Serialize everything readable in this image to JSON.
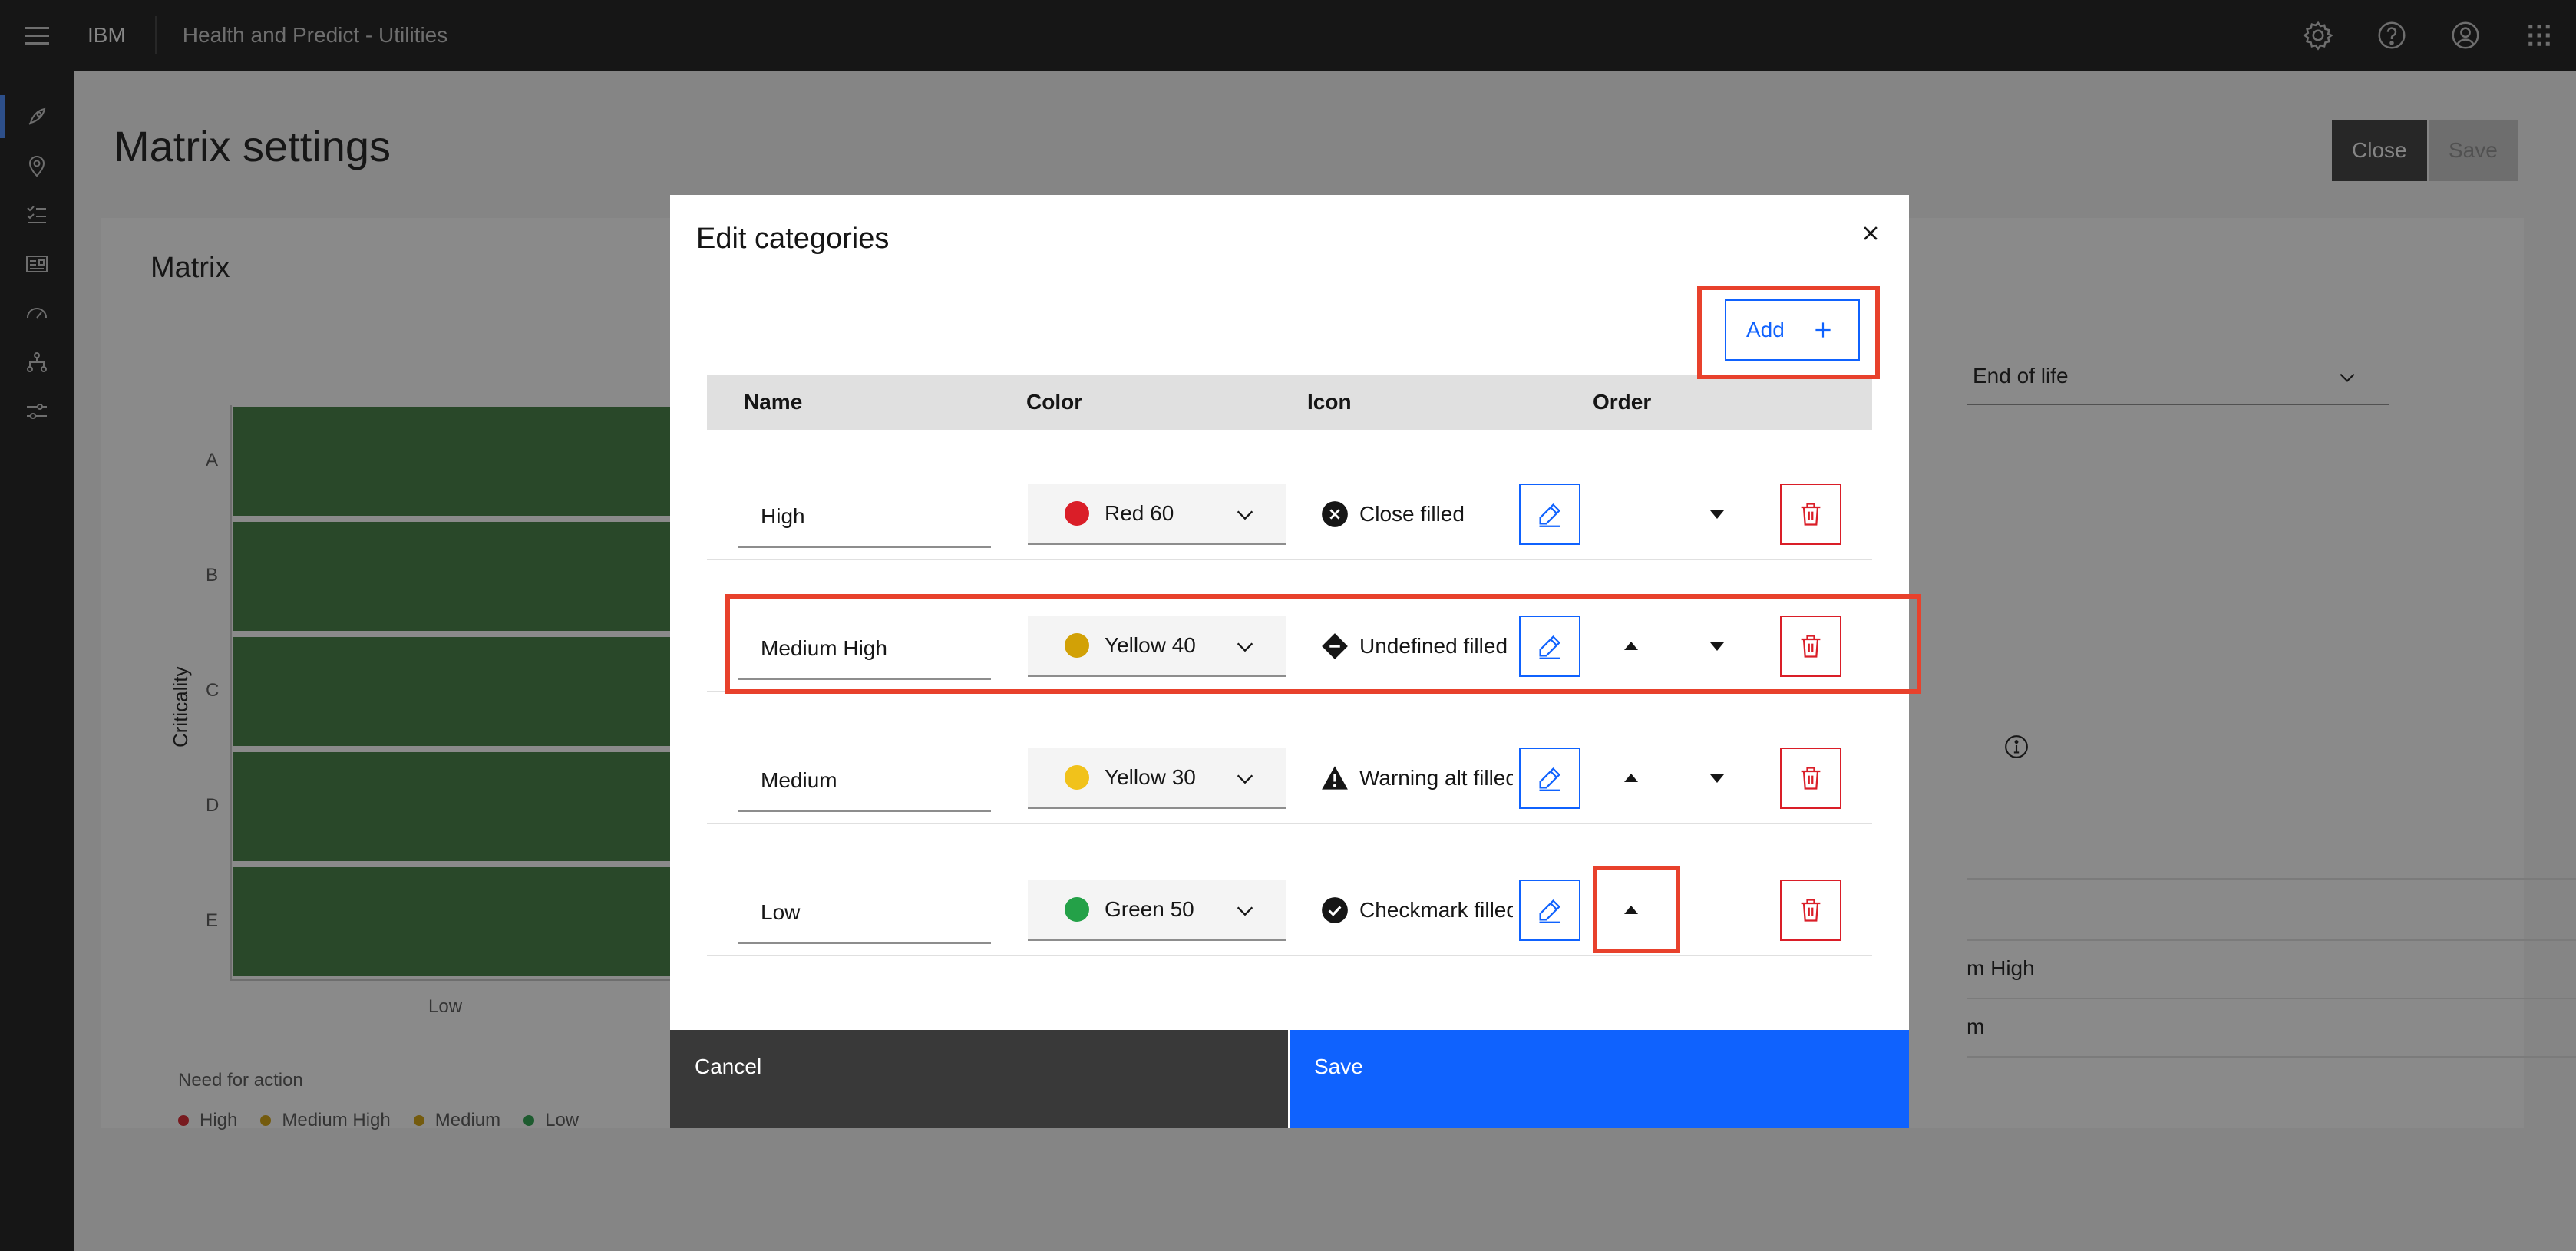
{
  "header": {
    "brand": "IBM",
    "app_title": "Health and Predict - Utilities",
    "icons": [
      "settings-icon",
      "help-icon",
      "user-avatar-icon",
      "app-switcher-icon"
    ]
  },
  "sidenav": {
    "icons": [
      "rocket-icon",
      "location-icon",
      "checklist-icon",
      "dashboard-icon",
      "meter-icon",
      "hierarchy-icon",
      "sliders-icon"
    ]
  },
  "page": {
    "title": "Matrix settings",
    "close_label": "Close",
    "save_label": "Save"
  },
  "matrix": {
    "title": "Matrix",
    "y_axis_label": "Criticality",
    "rows": [
      "A",
      "B",
      "C",
      "D",
      "E"
    ],
    "columns": [
      "Low"
    ],
    "cell_color": "#3d7a3d",
    "legend_title": "Need for action",
    "legend": [
      {
        "label": "High",
        "color": "#da1e28"
      },
      {
        "label": "Medium High",
        "color": "#d2a106"
      },
      {
        "label": "Medium",
        "color": "#d2a106"
      },
      {
        "label": "Low",
        "color": "#24a148"
      }
    ]
  },
  "right_panel": {
    "dropdown_value": "End of life",
    "partial_rows": [
      "m High",
      "m"
    ]
  },
  "modal": {
    "title": "Edit categories",
    "add_label": "Add",
    "columns": {
      "name": "Name",
      "color": "Color",
      "icon": "Icon",
      "order": "Order"
    },
    "rows": [
      {
        "name": "High",
        "color_label": "Red 60",
        "color_hex": "#da1e28",
        "icon_label": "Close filled",
        "icon": "close-filled-icon"
      },
      {
        "name": "Medium High",
        "color_label": "Yellow 40",
        "color_hex": "#d2a106",
        "icon_label": "Undefined filled",
        "icon": "undefined-filled-icon"
      },
      {
        "name": "Medium",
        "color_label": "Yellow 30",
        "color_hex": "#f1c21b",
        "icon_label": "Warning alt filled",
        "icon": "warning-alt-filled-icon"
      },
      {
        "name": "Low",
        "color_label": "Green 50",
        "color_hex": "#24a148",
        "icon_label": "Checkmark filled",
        "icon": "checkmark-filled-icon"
      }
    ],
    "cancel_label": "Cancel",
    "save_label": "Save"
  },
  "colors": {
    "primary": "#0f62fe",
    "danger": "#da1e28",
    "highlight": "#e8412c",
    "shell": "#161616"
  }
}
